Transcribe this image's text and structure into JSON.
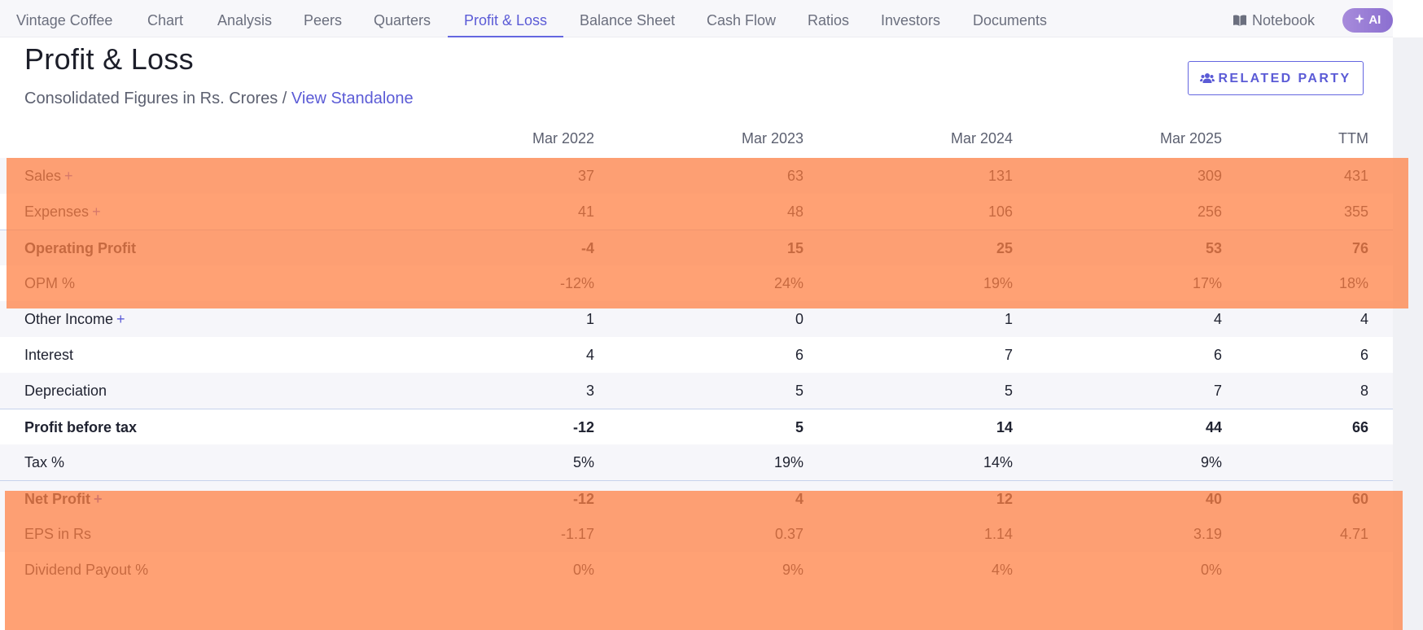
{
  "nav": {
    "tabs": [
      "Vintage Coffee",
      "Chart",
      "Analysis",
      "Peers",
      "Quarters",
      "Profit & Loss",
      "Balance Sheet",
      "Cash Flow",
      "Ratios",
      "Investors",
      "Documents"
    ],
    "active_tab": "Profit & Loss",
    "notebook_label": "Notebook",
    "ai_label": "AI"
  },
  "section": {
    "title": "Profit & Loss",
    "subtitle_text": "Consolidated Figures in Rs. Crores / ",
    "subtitle_link": "View Standalone",
    "related_party_label": "RELATED PARTY"
  },
  "table": {
    "columns": [
      "Mar 2022",
      "Mar 2023",
      "Mar 2024",
      "Mar 2025",
      "TTM"
    ],
    "rows": [
      {
        "label": "Sales",
        "expandable": true,
        "values": [
          "37",
          "63",
          "131",
          "309",
          "431"
        ]
      },
      {
        "label": "Expenses",
        "expandable": true,
        "values": [
          "41",
          "48",
          "106",
          "256",
          "355"
        ]
      },
      {
        "label": "Operating Profit",
        "expandable": false,
        "values": [
          "-4",
          "15",
          "25",
          "53",
          "76"
        ]
      },
      {
        "label": "OPM %",
        "expandable": false,
        "values": [
          "-12%",
          "24%",
          "19%",
          "17%",
          "18%"
        ]
      },
      {
        "label": "Other Income",
        "expandable": true,
        "values": [
          "1",
          "0",
          "1",
          "4",
          "4"
        ]
      },
      {
        "label": "Interest",
        "expandable": false,
        "values": [
          "4",
          "6",
          "7",
          "6",
          "6"
        ]
      },
      {
        "label": "Depreciation",
        "expandable": false,
        "values": [
          "3",
          "5",
          "5",
          "7",
          "8"
        ]
      },
      {
        "label": "Profit before tax",
        "expandable": false,
        "values": [
          "-12",
          "5",
          "14",
          "44",
          "66"
        ]
      },
      {
        "label": "Tax %",
        "expandable": false,
        "values": [
          "5%",
          "19%",
          "14%",
          "9%",
          ""
        ]
      },
      {
        "label": "Net Profit",
        "expandable": true,
        "values": [
          "-12",
          "4",
          "12",
          "40",
          "60"
        ]
      },
      {
        "label": "EPS in Rs",
        "expandable": false,
        "values": [
          "-1.17",
          "0.37",
          "1.14",
          "3.19",
          "4.71"
        ]
      },
      {
        "label": "Dividend Payout %",
        "expandable": false,
        "values": [
          "0%",
          "9%",
          "4%",
          "0%",
          ""
        ]
      }
    ],
    "plus_symbol": "+"
  },
  "colors": {
    "accent": "#5b5bd6",
    "highlight_overlay": "#ff8246"
  }
}
